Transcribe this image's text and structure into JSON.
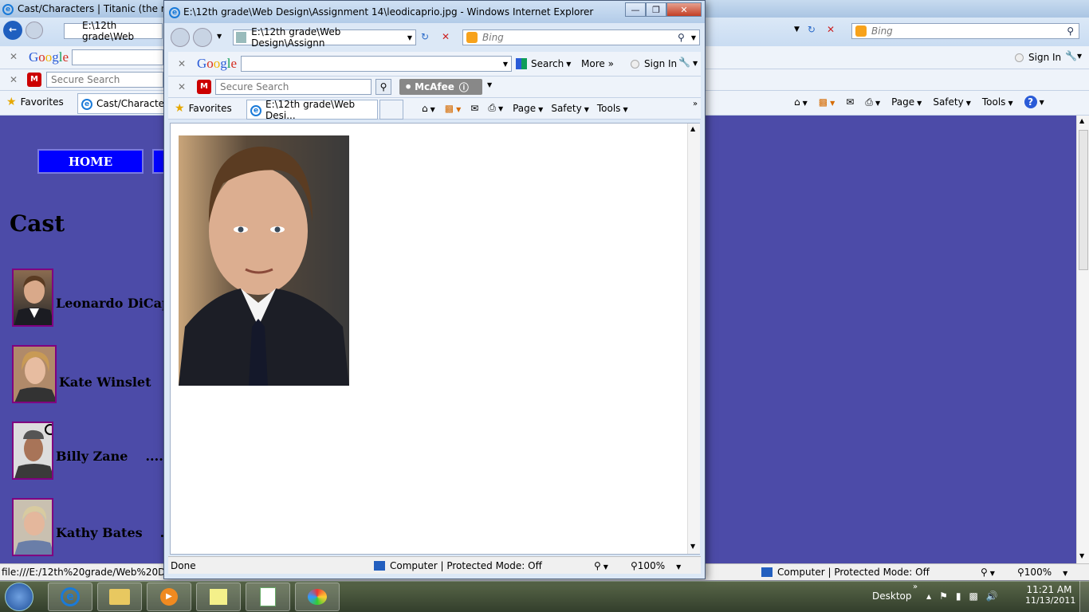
{
  "back_window": {
    "title": "Cast/Characters | Titanic (the mov",
    "address": "E:\\12th grade\\Web",
    "bing": "Bing",
    "google_label": "Google",
    "sign_in": "Sign In",
    "secure_search": "Secure Search",
    "favorites": "Favorites",
    "tab": "Cast/Characters",
    "menu": [
      "Page",
      "Safety",
      "Tools"
    ],
    "status_url": "file:///E:/12th%20grade/Web%20Desig",
    "status_zone": "Computer | Protected Mode: Off",
    "zoom": "100%"
  },
  "page": {
    "home": "HOME",
    "cast_heading": "Cast",
    "actors": [
      {
        "name": "Leonardo DiCap",
        "dots": ""
      },
      {
        "name": "Kate Winslet",
        "dots": "..."
      },
      {
        "name": "Billy Zane",
        "dots": "......."
      },
      {
        "name": "Kathy Bates",
        "dots": "...."
      }
    ]
  },
  "popup": {
    "title": "E:\\12th grade\\Web Design\\Assignment 14\\leodicaprio.jpg - Windows Internet Explorer",
    "address": "E:\\12th grade\\Web Design\\Assignn",
    "bing": "Bing",
    "google_label": "Google",
    "search": "Search",
    "more": "More",
    "sign_in": "Sign In",
    "secure_search": "Secure Search",
    "mcafee": "McAfee",
    "favorites": "Favorites",
    "tab": "E:\\12th grade\\Web Desi...",
    "menu": [
      "Page",
      "Safety",
      "Tools"
    ],
    "status_done": "Done",
    "status_zone": "Computer | Protected Mode: Off",
    "zoom": "100%"
  },
  "taskbar": {
    "desktop": "Desktop",
    "time": "11:21 AM",
    "date": "11/13/2011"
  },
  "colors": {
    "page_bg": "#4c4ba8",
    "home_btn": "#0000ff",
    "thumb_border": "#800080"
  }
}
